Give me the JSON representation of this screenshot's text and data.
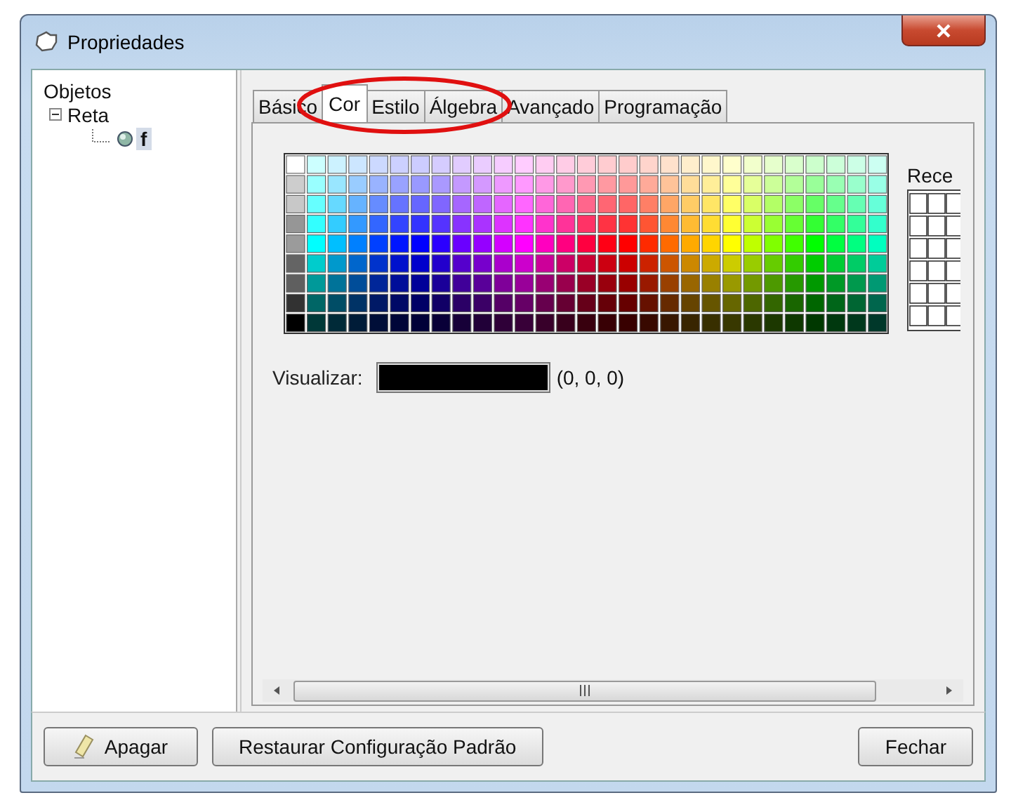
{
  "window": {
    "title": "Propriedades"
  },
  "tree": [
    {
      "label": "Objetos",
      "children": [
        {
          "label": "Reta",
          "expanded": true,
          "children": [
            {
              "label": "f",
              "selected": true
            }
          ]
        }
      ]
    }
  ],
  "tabs": [
    {
      "label": "Básico",
      "selected": false
    },
    {
      "label": "Cor",
      "selected": true
    },
    {
      "label": "Estilo",
      "selected": false
    },
    {
      "label": "Álgebra",
      "selected": false
    },
    {
      "label": "Avançado",
      "selected": false
    },
    {
      "label": "Programação",
      "selected": false
    }
  ],
  "color_panel": {
    "recent_label": "Rece",
    "preview": {
      "label": "Visualizar:",
      "color": "#000000",
      "value": "(0, 0, 0)"
    }
  },
  "buttons": [
    {
      "label": "Apagar",
      "kind": "eraser"
    },
    {
      "label": "Restaurar Configuração Padrão",
      "kind": "plain"
    },
    {
      "label": "Fechar",
      "kind": "plain"
    }
  ]
}
